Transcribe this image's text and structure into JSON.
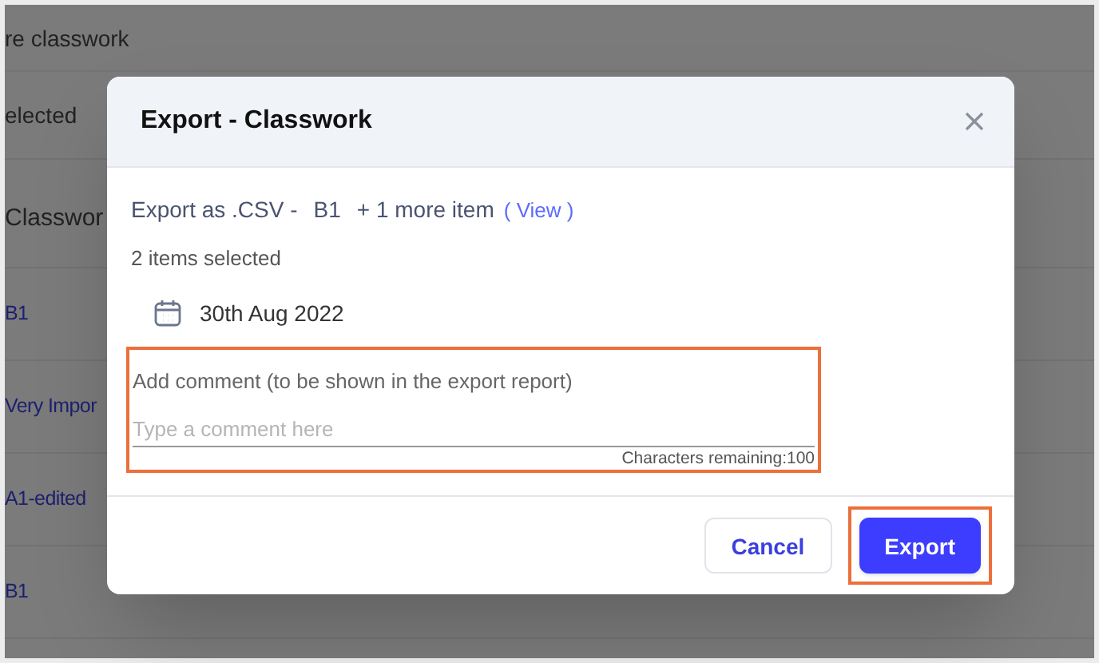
{
  "background": {
    "title": "re classwork",
    "toolbar_text": "elected",
    "column_header": "Classwor",
    "rows": [
      "B1",
      "Very Impor",
      "A1-edited",
      "B1"
    ]
  },
  "dialog": {
    "title": "Export - Classwork",
    "summary": {
      "format": "Export as .CSV -",
      "first_item": "B1",
      "more": "+ 1 more item",
      "view_link": "( View )"
    },
    "selected_count": "2 items selected",
    "date": "30th Aug 2022",
    "comment": {
      "label": "Add comment (to be shown in the export report)",
      "placeholder": "Type a comment here",
      "remaining": "Characters remaining:100",
      "highlighted": true
    },
    "buttons": [
      {
        "label": "Cancel",
        "kind": "secondary",
        "highlighted": false
      },
      {
        "label": "Export",
        "kind": "primary",
        "highlighted": true
      }
    ]
  }
}
